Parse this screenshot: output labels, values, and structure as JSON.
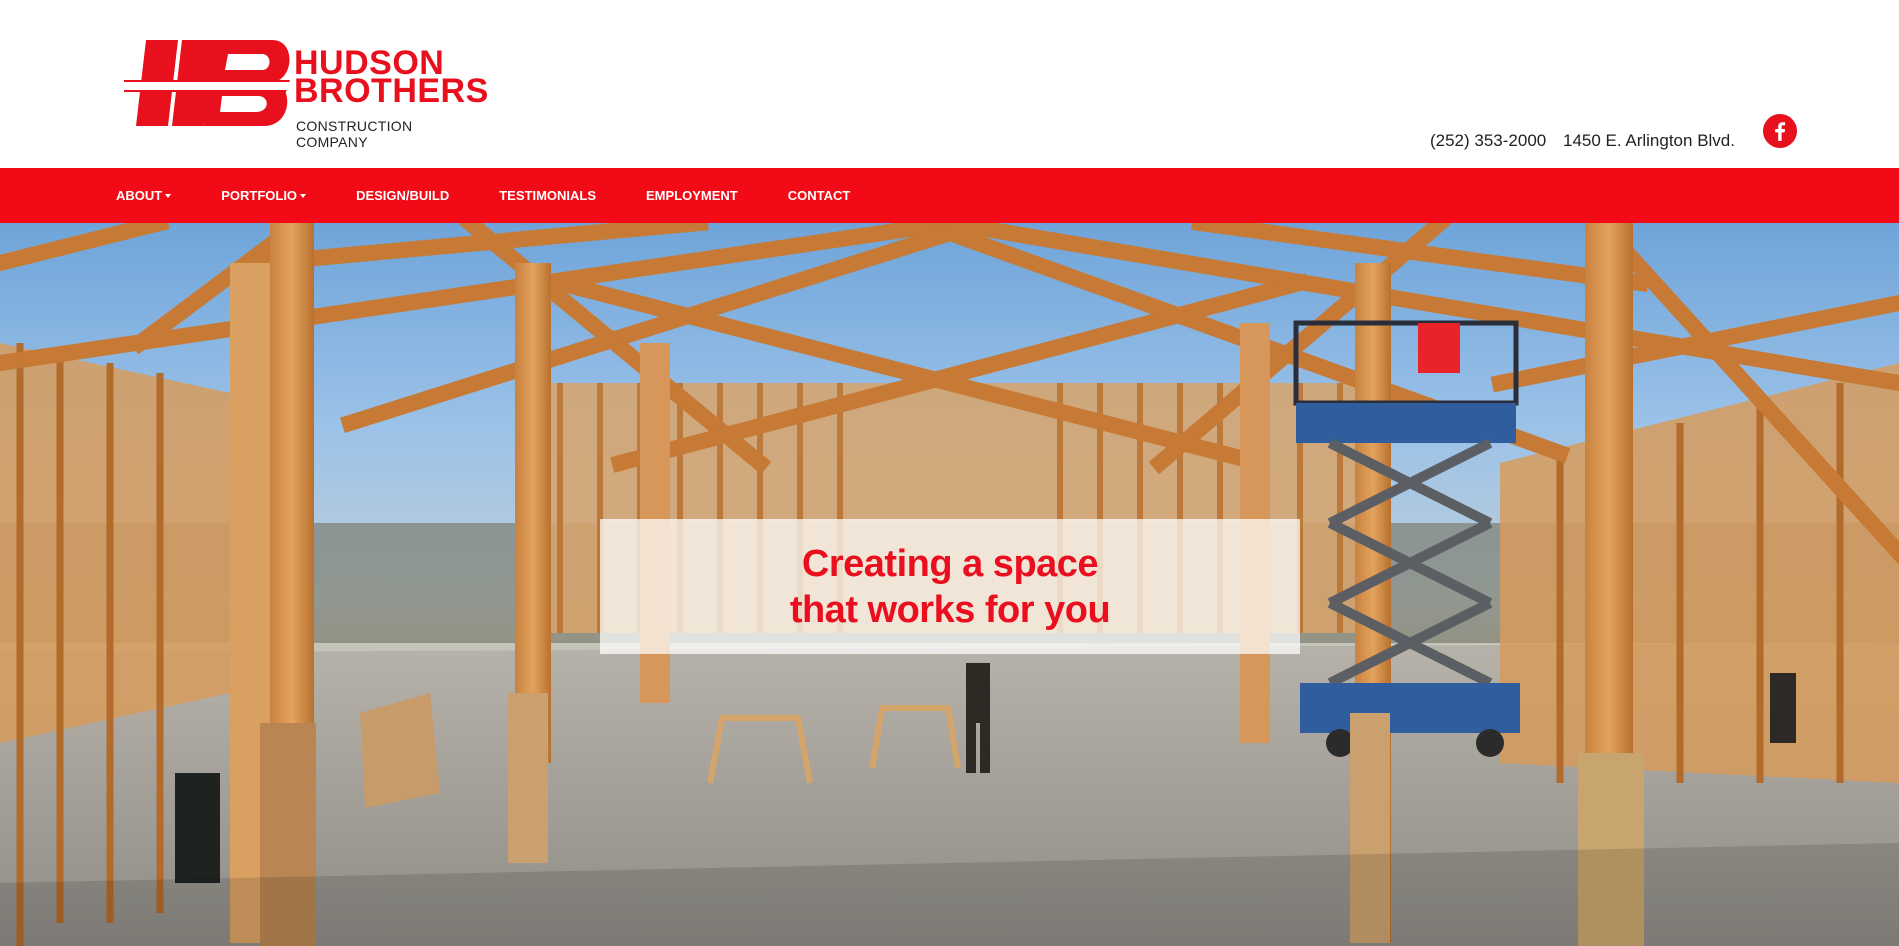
{
  "brand": {
    "name_line1": "HUDSON",
    "name_line2": "BROTHERS",
    "tagline": "CONSTRUCTION COMPANY",
    "color": "#e8101d"
  },
  "contact": {
    "phone": "(252) 353-2000",
    "address": "1450 E. Arlington Blvd.",
    "social_icon": "facebook-icon"
  },
  "nav": {
    "items": [
      {
        "label": "ABOUT",
        "dropdown": true
      },
      {
        "label": "PORTFOLIO",
        "dropdown": true
      },
      {
        "label": "DESIGN/BUILD",
        "dropdown": false
      },
      {
        "label": "TESTIMONIALS",
        "dropdown": false
      },
      {
        "label": "EMPLOYMENT",
        "dropdown": false
      },
      {
        "label": "CONTACT",
        "dropdown": false
      }
    ],
    "background": "#f20a16"
  },
  "hero": {
    "headline_line1": "Creating a space",
    "headline_line2": "that works for you"
  }
}
